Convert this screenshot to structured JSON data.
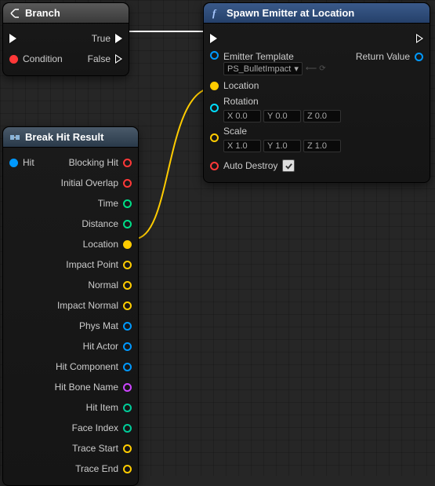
{
  "branch": {
    "title": "Branch",
    "true_label": "True",
    "false_label": "False",
    "condition_label": "Condition"
  },
  "break": {
    "title": "Break Hit Result",
    "hit_label": "Hit",
    "outputs": [
      {
        "name": "Blocking Hit",
        "color": "red"
      },
      {
        "name": "Initial Overlap",
        "color": "red"
      },
      {
        "name": "Time",
        "color": "green"
      },
      {
        "name": "Distance",
        "color": "green"
      },
      {
        "name": "Location",
        "color": "yellow",
        "filled": true
      },
      {
        "name": "Impact Point",
        "color": "yellow"
      },
      {
        "name": "Normal",
        "color": "yellow"
      },
      {
        "name": "Impact Normal",
        "color": "yellow"
      },
      {
        "name": "Phys Mat",
        "color": "blue"
      },
      {
        "name": "Hit Actor",
        "color": "blue"
      },
      {
        "name": "Hit Component",
        "color": "blue"
      },
      {
        "name": "Hit Bone Name",
        "color": "purple"
      },
      {
        "name": "Hit Item",
        "color": "teal"
      },
      {
        "name": "Face Index",
        "color": "teal"
      },
      {
        "name": "Trace Start",
        "color": "yellow"
      },
      {
        "name": "Trace End",
        "color": "yellow"
      }
    ]
  },
  "spawn": {
    "title": "Spawn Emitter at Location",
    "emitter_label": "Emitter Template",
    "emitter_value": "PS_BulletImpact",
    "return_label": "Return Value",
    "location_label": "Location",
    "rotation_label": "Rotation",
    "rotation": {
      "x": "0.0",
      "y": "0.0",
      "z": "0.0"
    },
    "scale_label": "Scale",
    "scale": {
      "x": "1.0",
      "y": "1.0",
      "z": "1.0"
    },
    "autodestroy_label": "Auto Destroy",
    "autodestroy": true,
    "axis": {
      "x": "X",
      "y": "Y",
      "z": "Z"
    }
  }
}
